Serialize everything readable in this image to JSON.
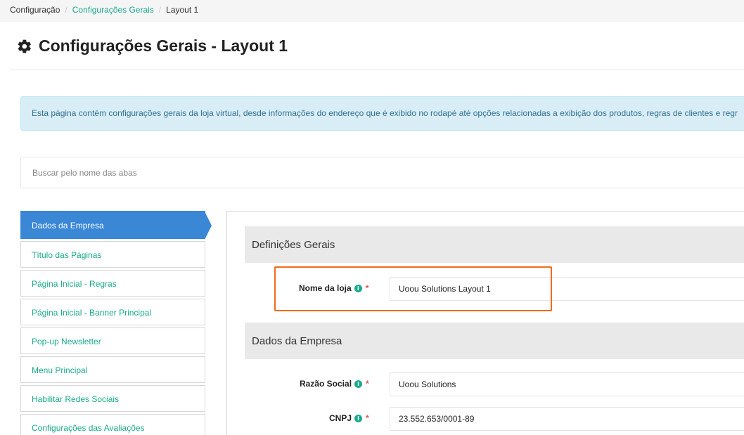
{
  "breadcrumb": {
    "items": [
      {
        "label": "Configuração",
        "link": false
      },
      {
        "label": "Configurações Gerais",
        "link": true
      },
      {
        "label": "Layout 1",
        "link": false
      }
    ],
    "separator": "/"
  },
  "page": {
    "title": "Configurações Gerais - Layout 1",
    "title_icon": "gear-icon"
  },
  "alert": {
    "text": "Esta página contém configurações gerais da loja virtual, desde informações do endereço que é exibido no rodapé até opções relacionadas a exibição dos produtos, regras de clientes e regr"
  },
  "search": {
    "placeholder": "Buscar pelo nome das abas",
    "value": ""
  },
  "sidebar": {
    "items": [
      {
        "label": "Dados da Empresa",
        "active": true
      },
      {
        "label": "Título das Páginas",
        "active": false
      },
      {
        "label": "Página Inicial - Regras",
        "active": false
      },
      {
        "label": "Página Inicial - Banner Principal",
        "active": false
      },
      {
        "label": "Pop-up Newsletter",
        "active": false
      },
      {
        "label": "Menu Principal",
        "active": false
      },
      {
        "label": "Habilitar Redes Sociais",
        "active": false
      },
      {
        "label": "Configurações das Avaliações",
        "active": false
      }
    ]
  },
  "sections": {
    "general": {
      "title": "Definições Gerais",
      "store_name": {
        "label": "Nome da loja",
        "info_icon": "info-icon",
        "required_mark": "*",
        "value": "Uoou Solutions Layout 1"
      }
    },
    "company": {
      "title": "Dados da Empresa",
      "corporate_name": {
        "label": "Razão Social",
        "info_icon": "info-icon",
        "required_mark": "*",
        "value": "Uoou Solutions"
      },
      "cnpj": {
        "label": "CNPJ",
        "info_icon": "info-icon",
        "required_mark": "*",
        "value": "23.552.653/0001-89"
      }
    }
  },
  "colors": {
    "accent": "#1aaa8a",
    "active_tab": "#3a87d6",
    "highlight": "#f26b1d",
    "alert_bg": "#d9edf7",
    "required": "#d9534f"
  }
}
